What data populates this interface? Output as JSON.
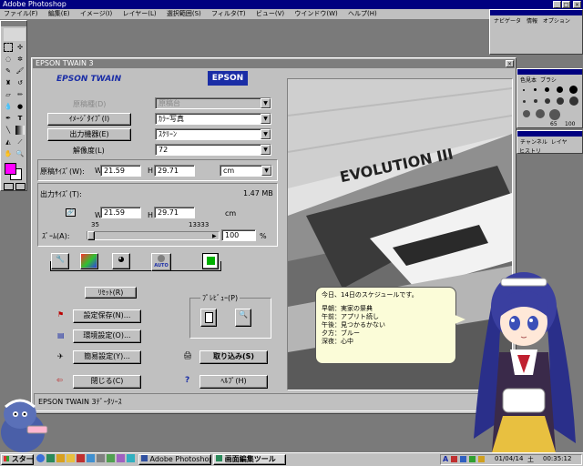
{
  "photoshop": {
    "title": "Adobe Photoshop",
    "menu": [
      "ファイル(F)",
      "編集(E)",
      "イメージ(I)",
      "レイヤー(L)",
      "選択範囲(S)",
      "フィルタ(T)",
      "ビュー(V)",
      "ウインドウ(W)",
      "ヘルプ(H)"
    ],
    "palettes": {
      "navigator_tabs": [
        "ナビゲータ",
        "情報",
        "オプション"
      ],
      "brush_tabs": [
        "色見本",
        "ブラシ"
      ],
      "channel_tabs": [
        "チャンネル",
        "レイヤ"
      ],
      "history_tab": "ヒストリ",
      "brush_sizes": [
        "65",
        "100"
      ]
    }
  },
  "twain": {
    "window_title": "EPSON TWAIN 3",
    "brand_text": "EPSON TWAIN",
    "logo_text": "EPSON",
    "document_source_label": "原稿種(D)",
    "document_source_value": "原稿台",
    "image_type_button": "ｲﾒｰｼﾞﾀｲﾌﾟ(I)",
    "image_type_value": "ｶﾗｰ写真",
    "output_device_button": "出力機器(E)",
    "output_device_value": "ｽｸﾘｰﾝ",
    "resolution_label": "解像度(L)",
    "resolution_value": "72",
    "original_size_label": "原稿ｻｲｽﾞ(W):",
    "original_w_label": "W",
    "original_w_value": "21.59",
    "original_h_label": "H",
    "original_h_value": "29.71",
    "unit_value": "cm",
    "output_size_label": "出力ｻｲｽﾞ(T):",
    "output_size_value": "1.47 MB",
    "output_w_label": "W",
    "output_w_value": "21.59",
    "output_h_label": "H",
    "output_h_value": "29.71",
    "output_unit": "cm",
    "zoom_label": "ｽﾞｰﾑ(A):",
    "zoom_min": "35",
    "zoom_max": "13333",
    "zoom_value": "100",
    "zoom_pct": "%",
    "zoom_level": 0.0049,
    "auto_label": "AUTO",
    "reset_button": "ﾘｾｯﾄ(R)",
    "preview_label": "ﾌﾟﾚﾋﾞｭｰ(P)",
    "save_settings_button": "設定保存(N)...",
    "environment_button": "環境設定(O)...",
    "simple_settings_button": "簡易設定(Y)...",
    "acquire_button": "取り込み(S)",
    "close_button": "閉じる(C)",
    "help_button": "ﾍﾙﾌﾟ(H)",
    "help_icon": "?",
    "status_text": "EPSON TWAIN 3ﾃﾞｰﾀｿｰｽ",
    "preview_image_text": "EVOLUTION III"
  },
  "schedule_note": {
    "title": "今日、14日のスケジュールです。",
    "lines": [
      "早朝：実家の祭典",
      "午前：アプリト続し",
      "午後：見つかるかない",
      "夕方：ブルー",
      "深夜：心中"
    ]
  },
  "taskbar": {
    "start_label": "スタート",
    "tasks": [
      "Adobe Photoshop",
      "画面編集ツール"
    ],
    "date": "01/04/14",
    "day": "土",
    "time": "00:35:12",
    "tray_letter": "A"
  },
  "colors": {
    "desktop": "#7a7a7a",
    "twain_blue": "#1a2da6",
    "foreground_swatch": "#ff00ff",
    "title_active": "#000080"
  }
}
